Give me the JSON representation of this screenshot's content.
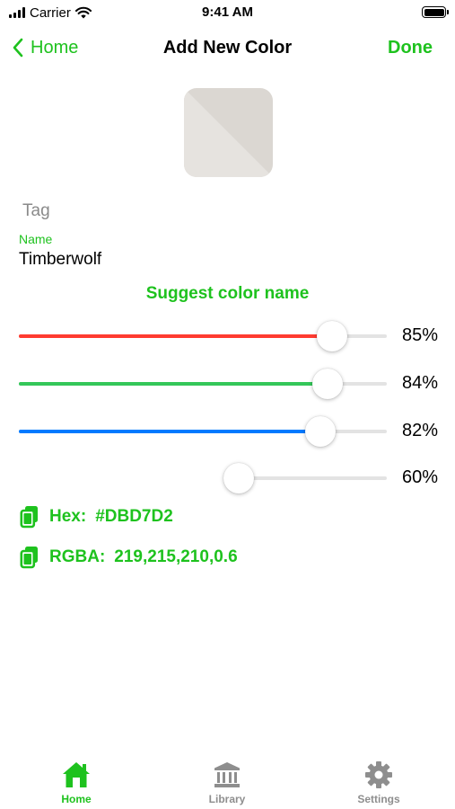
{
  "status_bar": {
    "carrier": "Carrier",
    "time": "9:41 AM"
  },
  "nav": {
    "back_label": "Home",
    "title": "Add New Color",
    "done_label": "Done"
  },
  "swatch": {
    "color": "#DBD7D2",
    "highlight": "#E6E3DF",
    "alpha": 0.6
  },
  "form": {
    "tag_placeholder": "Tag",
    "name_label": "Name",
    "name_value": "Timberwolf",
    "suggest_label": "Suggest color name"
  },
  "sliders": [
    {
      "id": "red",
      "percent_label": "85%",
      "value": 0.85,
      "color": "#ff3b30"
    },
    {
      "id": "green",
      "percent_label": "84%",
      "value": 0.84,
      "color": "#34c759"
    },
    {
      "id": "blue",
      "percent_label": "82%",
      "value": 0.82,
      "color": "#007aff"
    },
    {
      "id": "alpha",
      "percent_label": "60%",
      "value": 0.6,
      "color": null
    }
  ],
  "values": {
    "hex_label": "Hex:",
    "hex_value": "#DBD7D2",
    "rgba_label": "RGBA:",
    "rgba_value": "219,215,210,0.6"
  },
  "tabs": [
    {
      "label": "Home",
      "icon": "house-icon",
      "active": true
    },
    {
      "label": "Library",
      "icon": "building-columns-icon",
      "active": false
    },
    {
      "label": "Settings",
      "icon": "gear-icon",
      "active": false
    }
  ],
  "colors": {
    "accent": "#1ec21e",
    "inactive": "#8e8e8e"
  }
}
